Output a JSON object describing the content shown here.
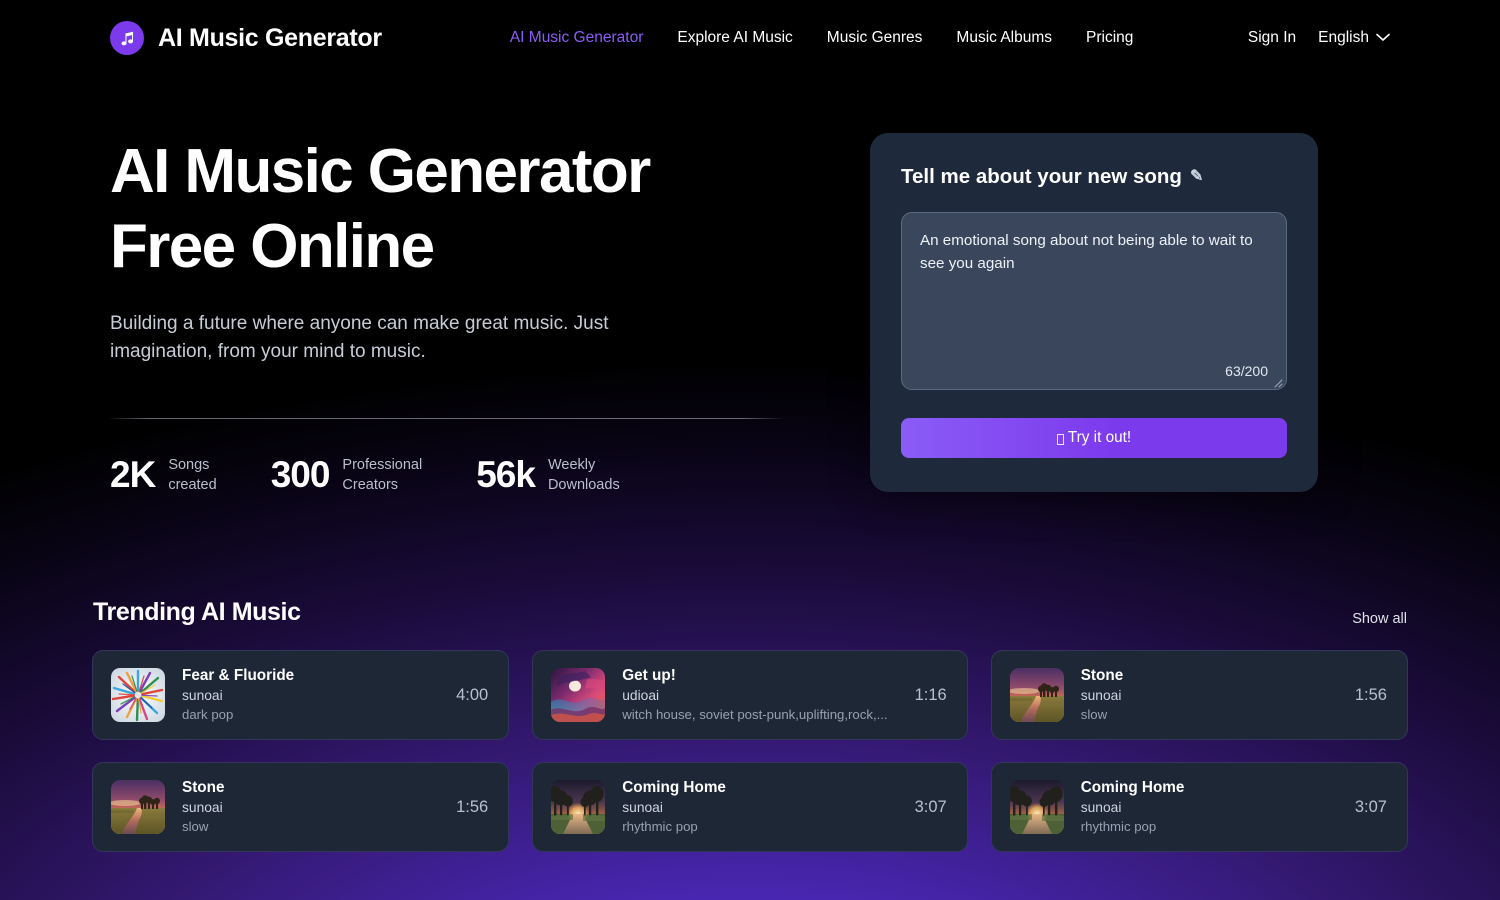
{
  "header": {
    "brand_name": "AI Music Generator",
    "logo_icon": "music-note-icon",
    "nav": [
      {
        "label": "AI Music Generator",
        "active": true
      },
      {
        "label": "Explore AI Music",
        "active": false
      },
      {
        "label": "Music Genres",
        "active": false
      },
      {
        "label": "Music Albums",
        "active": false
      },
      {
        "label": "Pricing",
        "active": false
      }
    ],
    "sign_in_label": "Sign In",
    "language_label": "English",
    "language_chevron_icon": "chevron-down-icon"
  },
  "hero": {
    "title_line1": "AI Music Generator",
    "title_line2": "Free Online",
    "subtitle": "Building a future where anyone can make great music. Just imagination, from your mind to music.",
    "stats": [
      {
        "value": "2K",
        "label": "Songs\ncreated"
      },
      {
        "value": "300",
        "label": "Professional\nCreators"
      },
      {
        "value": "56k",
        "label": "Weekly\nDownloads"
      }
    ]
  },
  "prompt_card": {
    "heading": "Tell me about your new song",
    "heading_icon": "pencil-writing-icon",
    "textarea_value": "An emotional song about not being able to wait to see you again",
    "textarea_placeholder": "Tell me about your new song",
    "char_counter": "63/200",
    "submit_label": "Try it out!",
    "submit_icon": "missing-glyph-box",
    "accent_color": "#7c3aed",
    "card_background": "#1e293b",
    "textarea_background": "#39465c"
  },
  "trending": {
    "title": "Trending AI Music",
    "show_all_label": "Show all",
    "tracks": [
      {
        "title": "Fear & Fluoride",
        "artist": "sunoai",
        "tags": "dark pop",
        "duration": "4:00",
        "art": "abstract-color-burst"
      },
      {
        "title": "Get up!",
        "artist": "udioai",
        "tags": "witch house, soviet post-punk,uplifting,rock,...",
        "duration": "1:16",
        "art": "pink-psychedelic-swirl"
      },
      {
        "title": "Stone",
        "artist": "sunoai",
        "tags": "slow",
        "duration": "1:56",
        "art": "sunset-river-landscape"
      },
      {
        "title": "Stone",
        "artist": "sunoai",
        "tags": "slow",
        "duration": "1:56",
        "art": "sunset-river-landscape"
      },
      {
        "title": "Coming Home",
        "artist": "sunoai",
        "tags": "rhythmic pop",
        "duration": "3:07",
        "art": "tree-lined-road-sunset"
      },
      {
        "title": "Coming Home",
        "artist": "sunoai",
        "tags": "rhythmic pop",
        "duration": "3:07",
        "art": "tree-lined-road-sunset"
      }
    ]
  }
}
